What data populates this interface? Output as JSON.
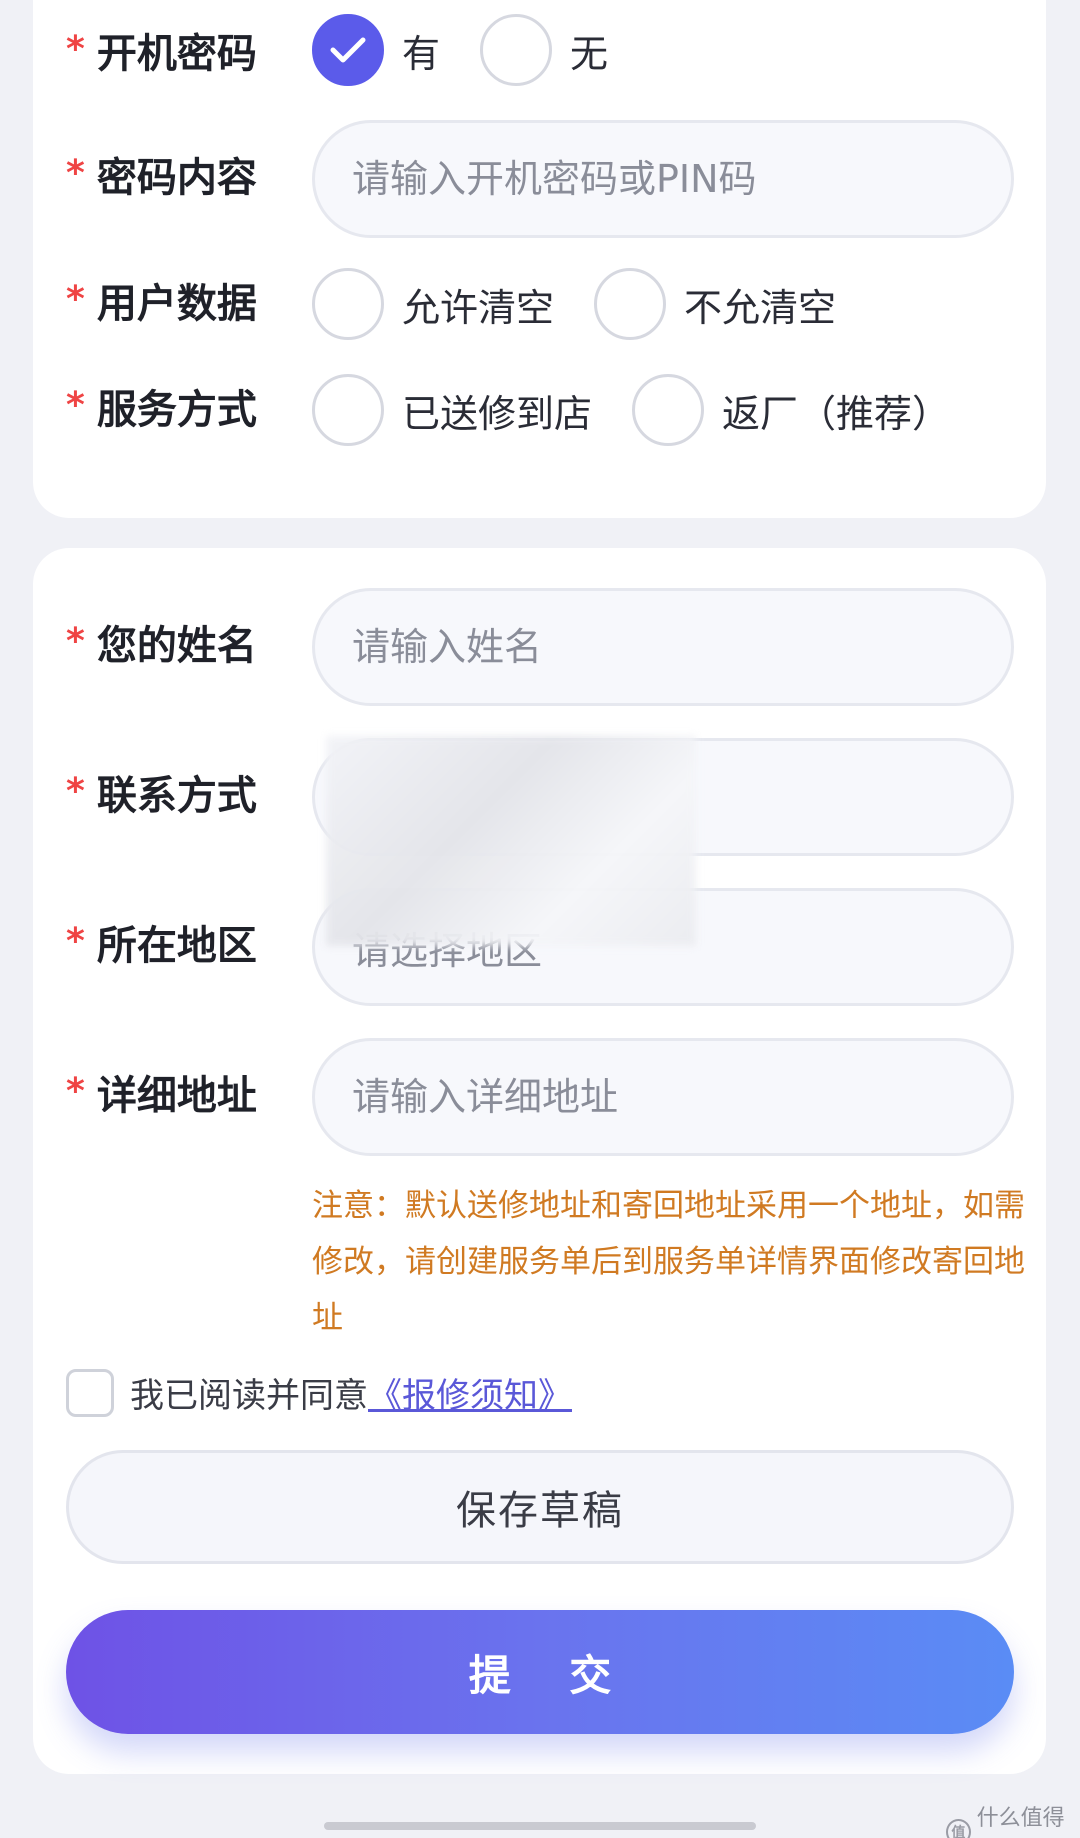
{
  "required_mark": "*",
  "section_device": {
    "boot_password": {
      "label": "开机密码",
      "options": [
        {
          "label": "有",
          "checked": true
        },
        {
          "label": "无",
          "checked": false
        }
      ]
    },
    "password_content": {
      "label": "密码内容",
      "placeholder": "请输入开机密码或PIN码"
    },
    "user_data": {
      "label": "用户数据",
      "options": [
        {
          "label": "允许清空",
          "checked": false
        },
        {
          "label": "不允清空",
          "checked": false
        }
      ]
    },
    "service_mode": {
      "label": "服务方式",
      "options": [
        {
          "label": "已送修到店",
          "checked": false
        },
        {
          "label": "返厂（推荐）",
          "checked": false
        }
      ]
    }
  },
  "section_contact": {
    "name": {
      "label": "您的姓名",
      "placeholder": "请输入姓名"
    },
    "contact": {
      "label": "联系方式"
    },
    "region": {
      "label": "所在地区",
      "placeholder": "请选择地区"
    },
    "address": {
      "label": "详细地址",
      "placeholder": "请输入详细地址"
    },
    "notice": "注意：默认送修地址和寄回地址采用一个地址，如需修改，请创建服务单后到服务单详情界面修改寄回地址"
  },
  "agreement": {
    "checked": false,
    "text": "我已阅读并同意",
    "link": "《报修须知》"
  },
  "buttons": {
    "save_draft": "保存草稿",
    "submit": "提 交"
  },
  "watermark": {
    "text": "什么值得买",
    "logo": "值"
  },
  "colors": {
    "accent": "#5b5bea",
    "required": "#ef4444",
    "notice": "#d07a22",
    "link": "#5a58d8"
  }
}
